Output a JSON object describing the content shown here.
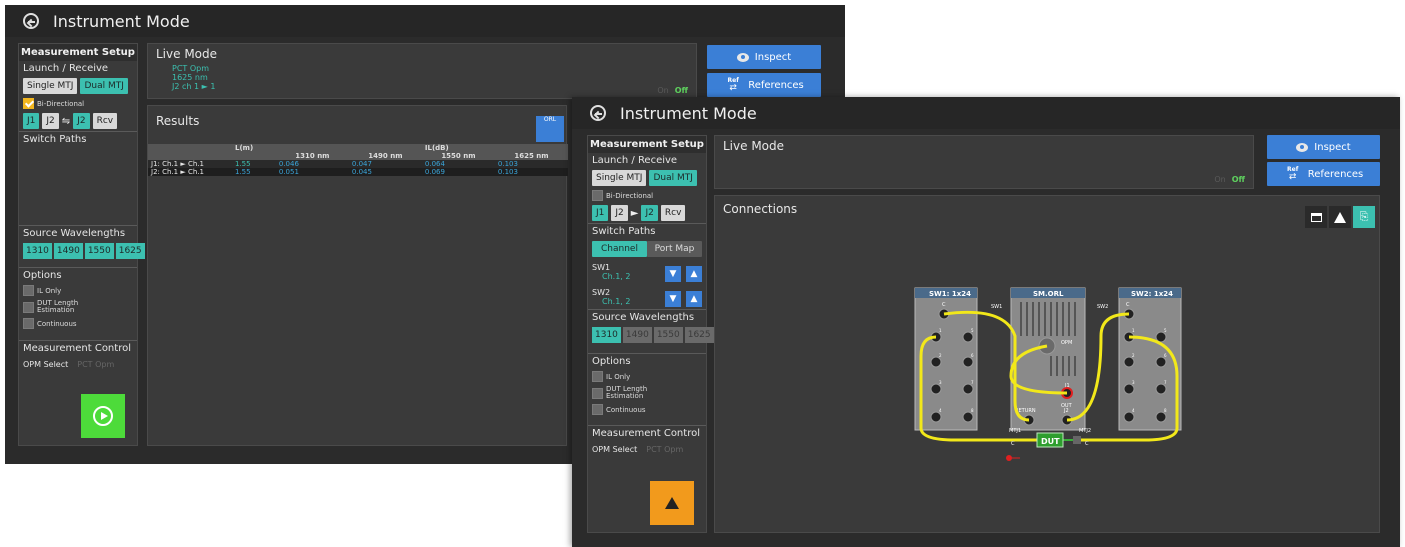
{
  "winA": {
    "title": "Instrument Mode",
    "setup": {
      "header": "Measurement Setup",
      "launch_label": "Launch / Receive",
      "single_mtj": "Single MTJ",
      "dual_mtj": "Dual MTJ",
      "bidir": "Bi-Directional",
      "j1": "J1",
      "j2": "J2",
      "j2b": "J2",
      "rcv": "Rcv",
      "switch_paths": "Switch Paths",
      "source_wl": "Source Wavelengths",
      "wavelengths": [
        "1310",
        "1490",
        "1550",
        "1625"
      ],
      "options": "Options",
      "opt_il": "IL Only",
      "opt_dut1": "DUT Length",
      "opt_dut2": "Estimation",
      "opt_cont": "Continuous",
      "meas_ctrl": "Measurement Control",
      "opm_select": "OPM Select",
      "pct_opm": "PCT Opm"
    },
    "live": {
      "title": "Live Mode",
      "line1": "PCT Opm",
      "line2": "1625 nm",
      "line3": "J2 ch 1 ► 1",
      "on": "On",
      "off": "Off"
    },
    "results": {
      "title": "Results",
      "col_l": "L(m)",
      "col_il": "IL(dB)",
      "wl_cols": [
        "1310 nm",
        "1490 nm",
        "1550 nm",
        "1625 nm"
      ],
      "rows": [
        {
          "label": "J1: Ch.1 ► Ch.1",
          "l": "1.55",
          "v": [
            "0.046",
            "0.047",
            "0.064",
            "0.103"
          ]
        },
        {
          "label": "J2: Ch.1 ► Ch.1",
          "l": "1.55",
          "v": [
            "0.051",
            "0.045",
            "0.069",
            "0.103"
          ]
        }
      ],
      "orl_icon": "ORL"
    },
    "inspect": "Inspect",
    "references": "References",
    "ref_small": "Ref"
  },
  "winB": {
    "title": "Instrument Mode",
    "setup": {
      "header": "Measurement Setup",
      "launch_label": "Launch / Receive",
      "single_mtj": "Single MTJ",
      "dual_mtj": "Dual MTJ",
      "bidir": "Bi-Directional",
      "j1": "J1",
      "j2": "J2",
      "j2b": "J2",
      "rcv": "Rcv",
      "switch_paths": "Switch Paths",
      "channel": "Channel",
      "port_map": "Port Map",
      "sw1": "SW1",
      "sw1_val": "Ch.1, 2",
      "sw2": "SW2",
      "sw2_val": "Ch.1, 2",
      "source_wl": "Source Wavelengths",
      "wavelengths": [
        "1310",
        "1490",
        "1550",
        "1625"
      ],
      "options": "Options",
      "opt_il": "IL Only",
      "opt_dut1": "DUT Length",
      "opt_dut2": "Estimation",
      "opt_cont": "Continuous",
      "meas_ctrl": "Measurement Control",
      "opm_select": "OPM Select",
      "pct_opm": "PCT Opm"
    },
    "live": {
      "title": "Live Mode",
      "on": "On",
      "off": "Off"
    },
    "connections": {
      "title": "Connections",
      "sw1": "SW1: 1x24",
      "smorl": "SM.ORL",
      "sw2": "SW2: 1x24",
      "sw1_port": "SW1",
      "sw2_port": "SW2",
      "opm": "OPM",
      "j1": "J1",
      "j2": "J2",
      "out": "OUT",
      "return": "RETURN",
      "mtj1": "MTJ1",
      "mtj2": "MTJ2",
      "dut": "DUT",
      "c": "C",
      "ports_left": [
        "1",
        "2",
        "3",
        "4"
      ],
      "ports_right": [
        "5",
        "6",
        "7",
        "8"
      ]
    },
    "inspect": "Inspect",
    "references": "References",
    "ref_small": "Ref"
  },
  "colors": {
    "teal": "#3cc0b0",
    "blue": "#3b7fd6",
    "green": "#4ddb3a",
    "orange": "#f29a1c",
    "yellow": "#f2e81a"
  }
}
